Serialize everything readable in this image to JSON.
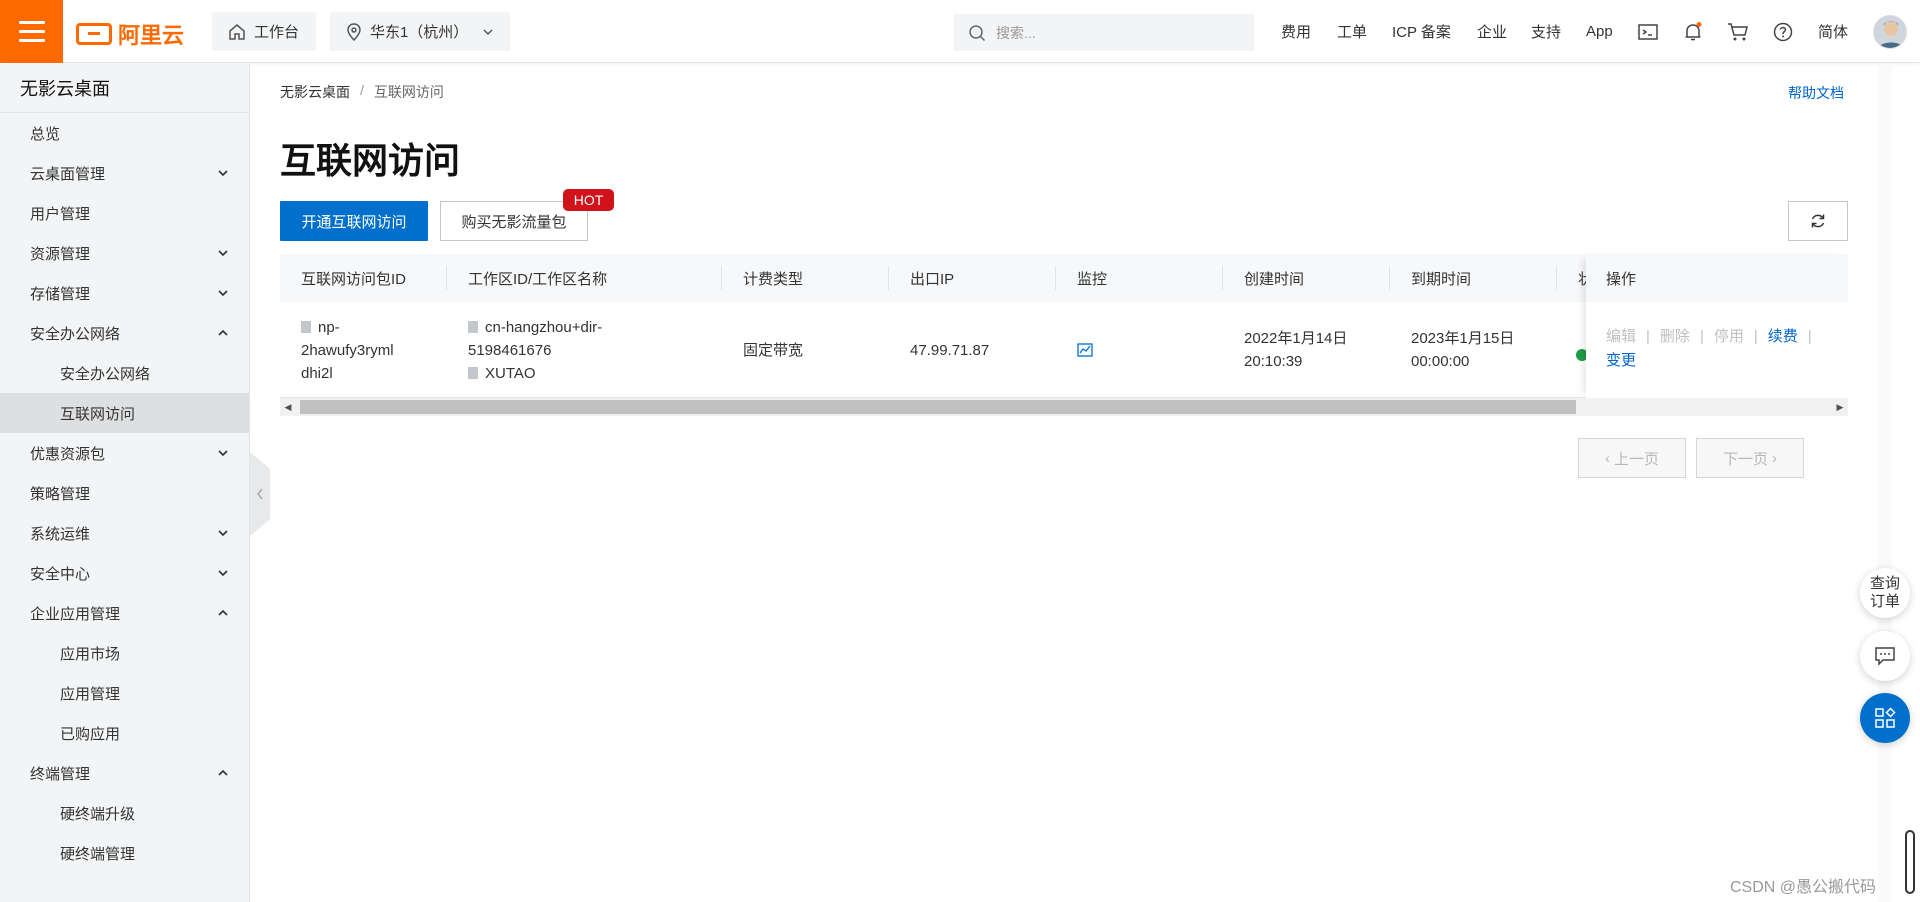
{
  "topbar": {
    "logo_text": "阿里云",
    "workbench_label": "工作台",
    "region_label": "华东1（杭州）",
    "search_placeholder": "搜索...",
    "nav": [
      "费用",
      "工单",
      "ICP 备案",
      "企业",
      "支持",
      "App"
    ],
    "lang_label": "简体"
  },
  "sidebar": {
    "title": "无影云桌面",
    "items": [
      {
        "label": "总览",
        "chevron": "none",
        "sub": false,
        "active": false
      },
      {
        "label": "云桌面管理",
        "chevron": "down",
        "sub": false,
        "active": false
      },
      {
        "label": "用户管理",
        "chevron": "none",
        "sub": false,
        "active": false
      },
      {
        "label": "资源管理",
        "chevron": "down",
        "sub": false,
        "active": false
      },
      {
        "label": "存储管理",
        "chevron": "down",
        "sub": false,
        "active": false
      },
      {
        "label": "安全办公网络",
        "chevron": "up",
        "sub": false,
        "active": false
      },
      {
        "label": "安全办公网络",
        "chevron": "none",
        "sub": true,
        "active": false
      },
      {
        "label": "互联网访问",
        "chevron": "none",
        "sub": true,
        "active": true
      },
      {
        "label": "优惠资源包",
        "chevron": "down",
        "sub": false,
        "active": false
      },
      {
        "label": "策略管理",
        "chevron": "none",
        "sub": false,
        "active": false
      },
      {
        "label": "系统运维",
        "chevron": "down",
        "sub": false,
        "active": false
      },
      {
        "label": "安全中心",
        "chevron": "down",
        "sub": false,
        "active": false
      },
      {
        "label": "企业应用管理",
        "chevron": "up",
        "sub": false,
        "active": false
      },
      {
        "label": "应用市场",
        "chevron": "none",
        "sub": true,
        "active": false
      },
      {
        "label": "应用管理",
        "chevron": "none",
        "sub": true,
        "active": false
      },
      {
        "label": "已购应用",
        "chevron": "none",
        "sub": true,
        "active": false
      },
      {
        "label": "终端管理",
        "chevron": "up",
        "sub": false,
        "active": false
      },
      {
        "label": "硬终端升级",
        "chevron": "none",
        "sub": true,
        "active": false
      },
      {
        "label": "硬终端管理",
        "chevron": "none",
        "sub": true,
        "active": false
      }
    ]
  },
  "breadcrumb": {
    "root": "无影云桌面",
    "sep": "/",
    "current": "互联网访问"
  },
  "help_link": "帮助文档",
  "page_title": "互联网访问",
  "actions": {
    "primary": "开通互联网访问",
    "secondary": "购买无影流量包",
    "hot_badge": "HOT"
  },
  "table": {
    "headers": [
      "互联网访问包ID",
      "工作区ID/工作区名称",
      "计费类型",
      "出口IP",
      "监控",
      "创建时间",
      "到期时间"
    ],
    "status_header_fragment": "状",
    "op_header": "操作",
    "row": {
      "id_lines": [
        "np-",
        "2hawufy3ryml",
        "dhi2l"
      ],
      "workspace_lines": [
        "cn-hangzhou+dir-",
        "5198461676"
      ],
      "workspace_name": "XUTAO",
      "billing": "固定带宽",
      "ip": "47.99.71.87",
      "created_lines": [
        "2022年1月14日",
        "20:10:39"
      ],
      "expire_lines": [
        "2023年1月15日",
        "00:00:00"
      ],
      "ops": {
        "edit": "编辑",
        "delete": "删除",
        "disable": "停用",
        "renew": "续费",
        "change": "变更",
        "sep": "|"
      }
    }
  },
  "pager": {
    "prev": "上一页",
    "next": "下一页"
  },
  "float": {
    "query_order_1": "查询",
    "query_order_2": "订单"
  },
  "watermark": "CSDN @愚公搬代码",
  "colors": {
    "brand": "#ff6a00",
    "primary": "#0070cc",
    "hot": "#d0121b",
    "status_ok": "#1e9b46"
  }
}
